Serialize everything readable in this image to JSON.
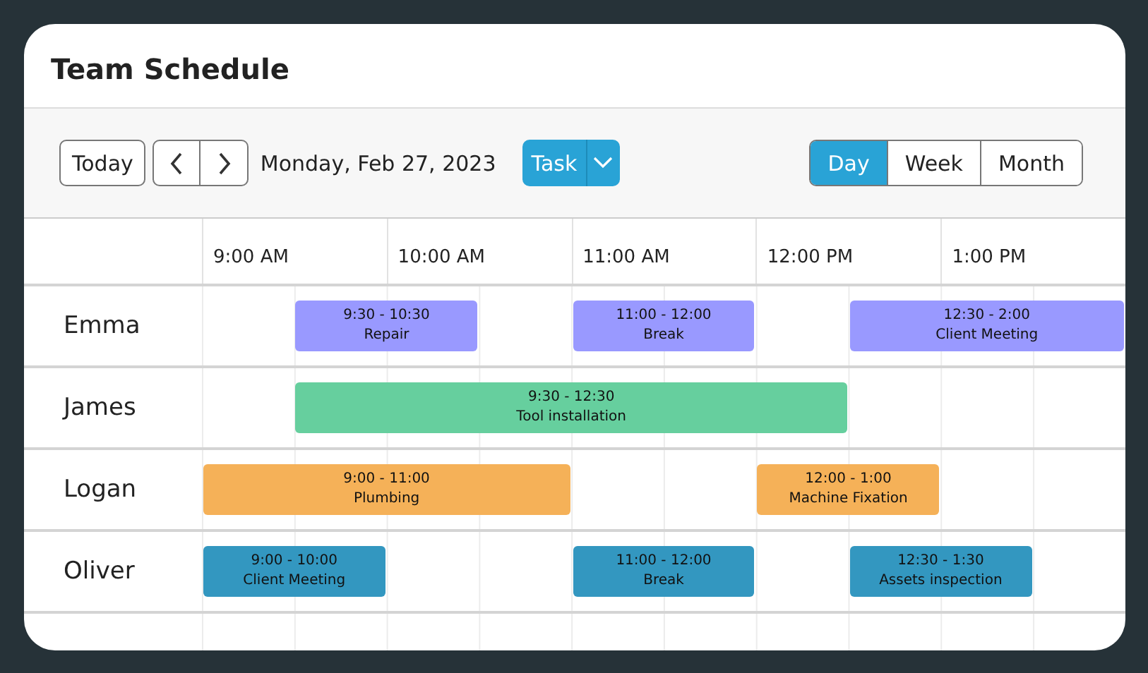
{
  "title": "Team Schedule",
  "toolbar": {
    "today_button": "Today",
    "date": "Monday, Feb 27, 2023",
    "task_button": "Task",
    "views": [
      {
        "label": "Day",
        "selected": true
      },
      {
        "label": "Week",
        "selected": false
      },
      {
        "label": "Month",
        "selected": false
      }
    ]
  },
  "time_columns": [
    "9:00 AM",
    "10:00 AM",
    "11:00 AM",
    "12:00 PM",
    "1:00 PM"
  ],
  "resources": [
    {
      "name": "Emma",
      "events": [
        {
          "time": "9:30 - 10:30",
          "title": "Repair",
          "color": "#9999ff"
        },
        {
          "time": "11:00 - 12:00",
          "title": "Break",
          "color": "#9999ff"
        },
        {
          "time": "12:30 - 2:00",
          "title": "Client Meeting",
          "color": "#9999ff"
        }
      ]
    },
    {
      "name": "James",
      "events": [
        {
          "time": "9:30 - 12:30",
          "title": "Tool installation",
          "color": "#66cf9e"
        }
      ]
    },
    {
      "name": "Logan",
      "events": [
        {
          "time": "9:00 - 11:00",
          "title": "Plumbing",
          "color": "#f5b158"
        },
        {
          "time": "12:00 - 1:00",
          "title": "Machine Fixation",
          "color": "#f5b158"
        }
      ]
    },
    {
      "name": "Oliver",
      "events": [
        {
          "time": "9:00 - 10:00",
          "title": "Client Meeting",
          "color": "#3397c0"
        },
        {
          "time": "11:00 - 12:00",
          "title": "Break",
          "color": "#3397c0"
        },
        {
          "time": "12:30 - 1:30",
          "title": "Assets inspection",
          "color": "#3397c0"
        }
      ]
    }
  ]
}
